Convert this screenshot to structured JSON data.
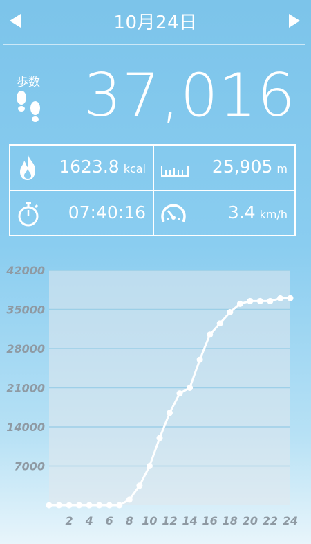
{
  "header": {
    "date_title": "10月24日",
    "prev_icon": "triangle-left",
    "next_icon": "triangle-right"
  },
  "steps": {
    "label": "歩数",
    "value": "37,016",
    "icon": "footprints-icon"
  },
  "stats": {
    "calories": {
      "value": "1623.8",
      "unit": "kcal",
      "icon": "flame-icon"
    },
    "distance": {
      "value": "25,905",
      "unit": "m",
      "icon": "ruler-icon"
    },
    "duration": {
      "value": "07:40:16",
      "icon": "stopwatch-icon"
    },
    "speed": {
      "value": "3.4",
      "unit": "km/h",
      "icon": "speedometer-icon"
    }
  },
  "colors": {
    "background_top": "#7cc4ea",
    "background_bottom": "#e8f5fb",
    "foreground": "#ffffff",
    "axis_label": "#8f9aa3"
  },
  "chart_data": {
    "type": "line",
    "title": "",
    "xlabel": "",
    "ylabel": "",
    "cumulative": true,
    "x": [
      0,
      1,
      2,
      3,
      4,
      5,
      6,
      7,
      8,
      9,
      10,
      11,
      12,
      13,
      14,
      15,
      16,
      17,
      18,
      19,
      20,
      21,
      22,
      23,
      24
    ],
    "series": [
      {
        "values": [
          0,
          0,
          0,
          0,
          0,
          0,
          0,
          0,
          1000,
          3500,
          7000,
          12000,
          16500,
          20000,
          21000,
          26000,
          30500,
          32500,
          34500,
          36000,
          36500,
          36500,
          36500,
          37000,
          37016
        ]
      }
    ],
    "x_tick_labels": [
      "2",
      "4",
      "6",
      "8",
      "10",
      "12",
      "14",
      "16",
      "18",
      "20",
      "22",
      "24"
    ],
    "y_tick_labels": [
      "7000",
      "14000",
      "21000",
      "28000",
      "35000",
      "42000"
    ],
    "xlim": [
      0,
      24
    ],
    "ylim": [
      0,
      42000
    ],
    "grid": "horizontal",
    "legend": "none"
  }
}
